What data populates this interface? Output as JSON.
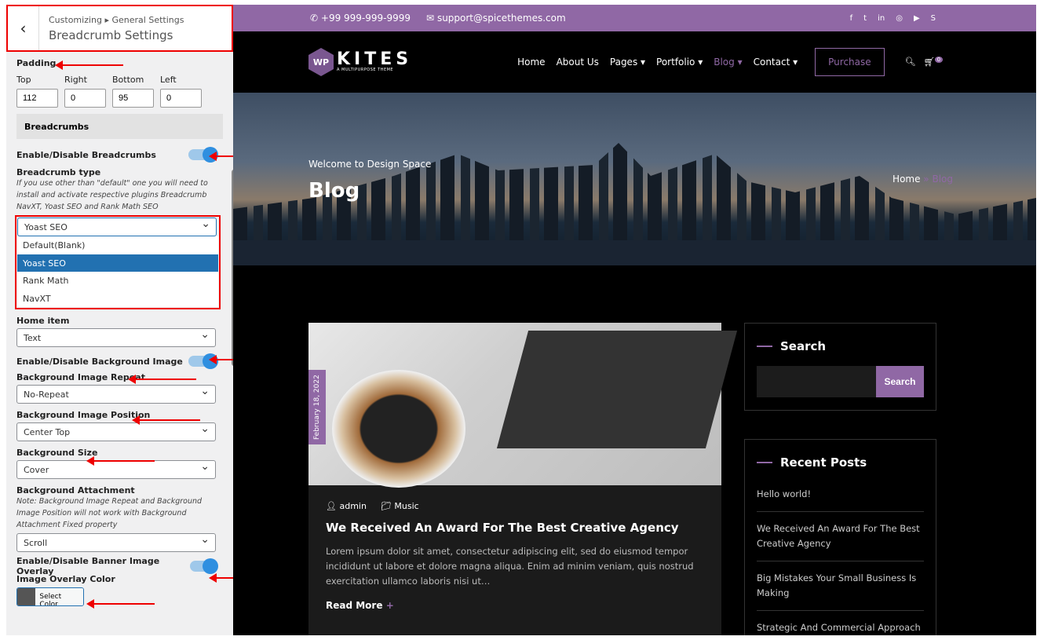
{
  "sidebar": {
    "crumb": "Customizing ▸ General Settings",
    "title": "Breadcrumb Settings",
    "padding_label": "Padding",
    "padding": [
      {
        "label": "Top",
        "value": "112"
      },
      {
        "label": "Right",
        "value": "0"
      },
      {
        "label": "Bottom",
        "value": "95"
      },
      {
        "label": "Left",
        "value": "0"
      }
    ],
    "section": "Breadcrumbs",
    "enable_breadcrumbs": "Enable/Disable Breadcrumbs",
    "type_label": "Breadcrumb type",
    "type_note": "If you use other than \"default\" one you will need to install and activate respective plugins Breadcrumb NavXT, Yoast SEO and Rank Math SEO",
    "type_value": "Yoast SEO",
    "type_options": [
      "Default(Blank)",
      "Yoast SEO",
      "Rank Math",
      "NavXT"
    ],
    "home_label": "Home item",
    "home_value": "Text",
    "enable_bg": "Enable/Disable Background Image",
    "repeat_label": "Background Image Repeat",
    "repeat_value": "No-Repeat",
    "position_label": "Background Image Position",
    "position_value": "Center Top",
    "size_label": "Background Size",
    "size_value": "Cover",
    "attach_label": "Background Attachment",
    "attach_note": "Note: Background Image Repeat and Background Image Position will not work with Background Attachment Fixed property",
    "attach_value": "Scroll",
    "enable_overlay": "Enable/Disable Banner Image Overlay",
    "overlay_label": "Image Overlay Color",
    "select_color": "Select Color"
  },
  "preview": {
    "phone": "+99 999-999-9999",
    "email": "support@spicethemes.com",
    "logo": {
      "mark": "WP",
      "name": "KITES",
      "tagline": "A MULTIPURPOSE THEME"
    },
    "nav": [
      "Home",
      "About Us",
      "Pages ▾",
      "Portfolio ▾",
      "Blog ▾",
      "Contact ▾"
    ],
    "purchase": "Purchase",
    "cart_count": "0",
    "welcome": "Welcome to Design Space",
    "page_title": "Blog",
    "bc_home": "Home",
    "bc_sep": " » ",
    "bc_current": "Blog",
    "post": {
      "date": "February 18, 2022",
      "author": "admin",
      "category": "Music",
      "title": "We Received An Award For The Best Creative Agency",
      "excerpt": "Lorem ipsum dolor sit amet, consectetur adipiscing elit, sed do eiusmod tempor incididunt ut labore et dolore magna aliqua. Enim ad minim veniam, quis nostrud exercitation ullamco laboris nisi ut…",
      "read_more": "Read More",
      "plus": "+"
    },
    "search_title": "Search",
    "search_button": "Search",
    "recent_title": "Recent Posts",
    "recent": [
      "Hello world!",
      "We Received An Award For The Best Creative Agency",
      "Big Mistakes Your Small Business Is Making",
      "Strategic And Commercial Approach With Issues"
    ]
  }
}
